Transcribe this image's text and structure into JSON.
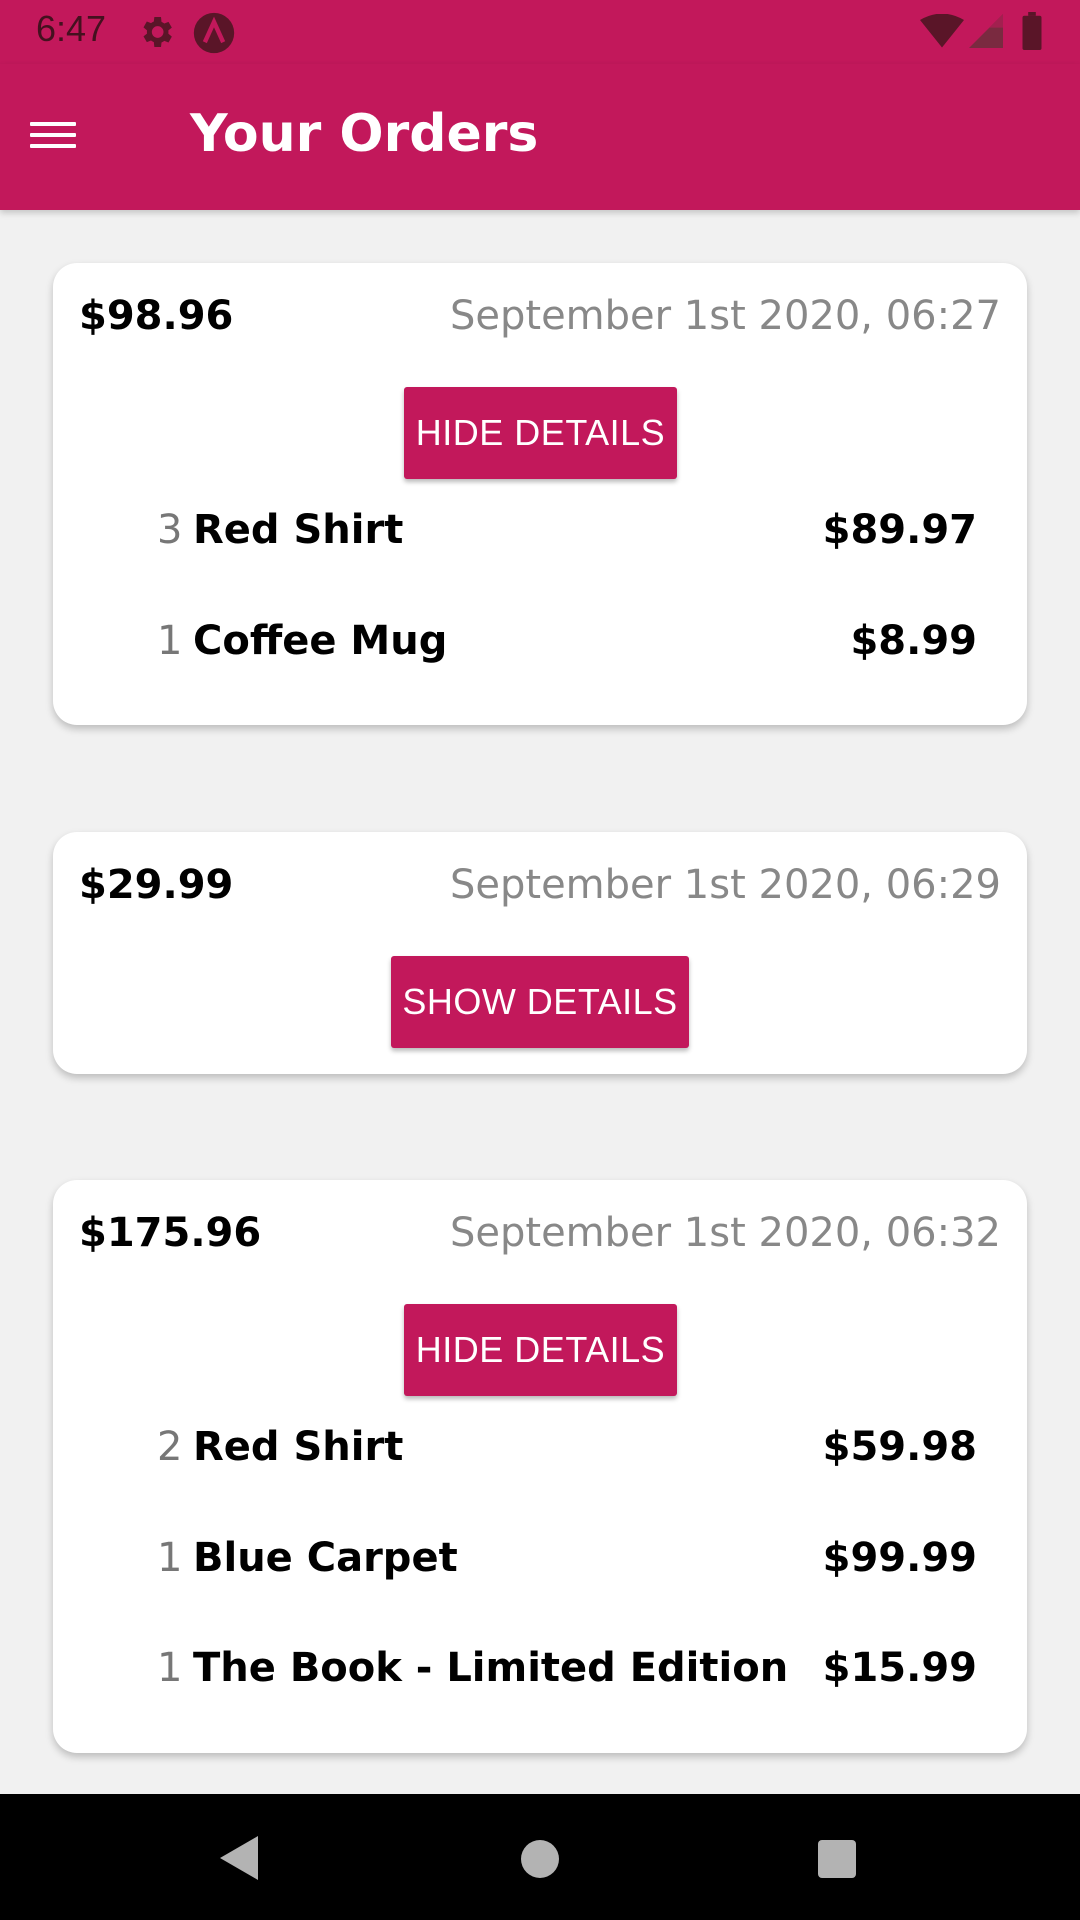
{
  "status_bar": {
    "time": "6:47"
  },
  "app_bar": {
    "title": "Your Orders"
  },
  "orders": [
    {
      "total": "$98.96",
      "date": "September 1st 2020, 06:27",
      "toggle_label": "HIDE DETAILS",
      "items": [
        {
          "qty": "3",
          "name": "Red Shirt",
          "price": "$89.97"
        },
        {
          "qty": "1",
          "name": "Coffee Mug",
          "price": "$8.99"
        }
      ]
    },
    {
      "total": "$29.99",
      "date": "September 1st 2020, 06:29",
      "toggle_label": "SHOW DETAILS",
      "items": []
    },
    {
      "total": "$175.96",
      "date": "September 1st 2020, 06:32",
      "toggle_label": "HIDE DETAILS",
      "items": [
        {
          "qty": "2",
          "name": "Red Shirt",
          "price": "$59.98"
        },
        {
          "qty": "1",
          "name": "Blue Carpet",
          "price": "$99.99"
        },
        {
          "qty": "1",
          "name": "The Book - Limited Edition",
          "price": "$15.99"
        }
      ]
    }
  ],
  "icons": {
    "status_left": [
      "gear-icon",
      "a-icon"
    ],
    "status_right": [
      "wifi-icon",
      "signal-icon",
      "battery-icon"
    ],
    "app_bar": "menu-icon",
    "nav_bar": [
      "back-icon",
      "home-icon",
      "recents-icon"
    ]
  },
  "colors": {
    "primary": "#c2185b",
    "background": "#f1f1f1",
    "card": "#ffffff",
    "date_text": "#888888"
  }
}
